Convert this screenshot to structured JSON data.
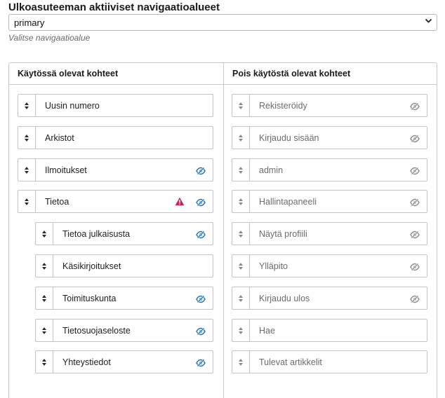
{
  "form": {
    "title": "Ulkoasuteeman aktiiviset navigaatioalueet",
    "select_value": "primary",
    "hint": "Valitse navigaatioalue"
  },
  "columns": {
    "enabled_header": "Käytössä olevat kohteet",
    "disabled_header": "Pois käytöstä olevat kohteet"
  },
  "enabled_items": [
    {
      "label": "Uusin numero",
      "level": 0,
      "hidden_icon": false,
      "warning": false
    },
    {
      "label": "Arkistot",
      "level": 0,
      "hidden_icon": false,
      "warning": false
    },
    {
      "label": "Ilmoitukset",
      "level": 0,
      "hidden_icon": true,
      "warning": false
    },
    {
      "label": "Tietoa",
      "level": 0,
      "hidden_icon": true,
      "warning": true
    },
    {
      "label": "Tietoa julkaisusta",
      "level": 1,
      "hidden_icon": true,
      "warning": false
    },
    {
      "label": "Käsikirjoitukset",
      "level": 1,
      "hidden_icon": false,
      "warning": false
    },
    {
      "label": "Toimituskunta",
      "level": 1,
      "hidden_icon": true,
      "warning": false
    },
    {
      "label": "Tietosuojaseloste",
      "level": 1,
      "hidden_icon": true,
      "warning": false
    },
    {
      "label": "Yhteystiedot",
      "level": 1,
      "hidden_icon": true,
      "warning": false
    }
  ],
  "disabled_items": [
    {
      "label": "Rekisteröidy",
      "hidden_icon": true
    },
    {
      "label": "Kirjaudu sisään",
      "hidden_icon": true
    },
    {
      "label": "admin",
      "hidden_icon": true
    },
    {
      "label": "Hallintapaneeli",
      "hidden_icon": true
    },
    {
      "label": "Näytä profiili",
      "hidden_icon": true
    },
    {
      "label": "Ylläpito",
      "hidden_icon": true
    },
    {
      "label": "Kirjaudu ulos",
      "hidden_icon": true
    },
    {
      "label": "Hae",
      "hidden_icon": false
    },
    {
      "label": "Tulevat artikkelit",
      "hidden_icon": false
    }
  ],
  "icons": {
    "handle": "sort-arrows-icon",
    "visibility": "eye-slash-icon",
    "warning": "warning-triangle-icon"
  },
  "colors": {
    "eye_enabled": "#2271b1",
    "eye_disabled": "#8c8c8c",
    "warning": "#c4264f"
  }
}
